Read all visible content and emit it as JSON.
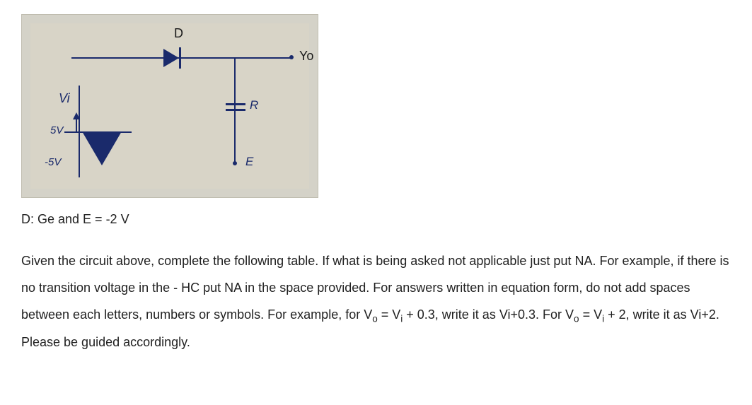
{
  "circuit": {
    "labels": {
      "d": "D",
      "yo": "Yo",
      "vi": "Vi",
      "r": "R",
      "five_v": "5V",
      "neg_five_v": "-5V",
      "e": "E"
    }
  },
  "caption": "D: Ge and E = -2 V",
  "instructions": {
    "p1": "Given the circuit above, complete the following table. If what is being asked not applicable just put NA. For example, if there is no transition voltage in the - HC put NA in the space provided. For answers written in equation form, do not add spaces between each letters, numbers or symbols. For example, for V",
    "sub_o1": "o",
    "p2": " = V",
    "sub_i1": "i",
    "p3": " + 0.3, write it as Vi+0.3. For V",
    "sub_o2": "o",
    "p4": " = V",
    "sub_i2": "i",
    "p5": " + 2, write it as Vi+2. Please be guided accordingly."
  }
}
